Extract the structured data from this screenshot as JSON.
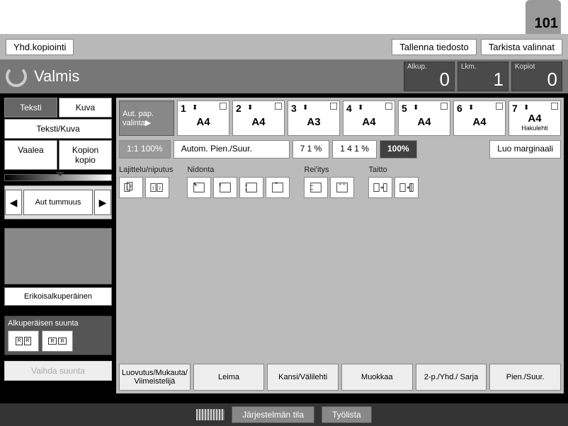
{
  "top": {
    "pageNum": "101",
    "combine": "Yhd.kopiointi",
    "save": "Tallenna tiedosto",
    "check": "Tarkista valinnat"
  },
  "status": {
    "text": "Valmis",
    "counters": [
      {
        "label": "Alkup.",
        "value": "0"
      },
      {
        "label": "Lkm.",
        "value": "1"
      },
      {
        "label": "Kopiot",
        "value": "0"
      }
    ]
  },
  "left": {
    "modes": {
      "teksti": "Teksti",
      "kuva": "Kuva",
      "tekstikuva": "Teksti/Kuva",
      "vaalea": "Vaalea",
      "kopionkopio": "Kopion kopio"
    },
    "darkness": "Aut tummuus",
    "special": "Erikoisalkuperäinen",
    "orientTitle": "Alkuperäisen suunta",
    "changeDir": "Vaihda suunta"
  },
  "trays": {
    "auto": "Aut. pap. valinta▶",
    "items": [
      {
        "n": "1",
        "size": "A4",
        "sub": ""
      },
      {
        "n": "2",
        "size": "A4",
        "sub": ""
      },
      {
        "n": "3",
        "size": "A3",
        "sub": ""
      },
      {
        "n": "4",
        "size": "A4",
        "sub": ""
      },
      {
        "n": "5",
        "size": "A4",
        "sub": ""
      },
      {
        "n": "6",
        "size": "A4",
        "sub": ""
      },
      {
        "n": "7",
        "size": "A4",
        "sub": "Hakulehti"
      }
    ]
  },
  "zoom": {
    "oneToOne": "1:1 100%",
    "auto": "Autom. Pien./Suur.",
    "z71": "7 1 %",
    "z141": "1 4 1 %",
    "z100": "100%",
    "margin": "Luo marginaali"
  },
  "finish": {
    "sort": "Lajittelu/niputus",
    "staple": "Nidonta",
    "punch": "Rei'itys",
    "fold": "Taitto"
  },
  "tabs": {
    "output": "Luovutus/Mukauta/\nViimeistelijä",
    "stamp": "Leima",
    "cover": "Kansi/Välilehti",
    "edit": "Muokkaa",
    "duplex": "2-p./Yhd./\nSarja",
    "reduce": "Pien./Suur."
  },
  "footer": {
    "system": "Järjestelmän tila",
    "jobs": "Työlista"
  }
}
